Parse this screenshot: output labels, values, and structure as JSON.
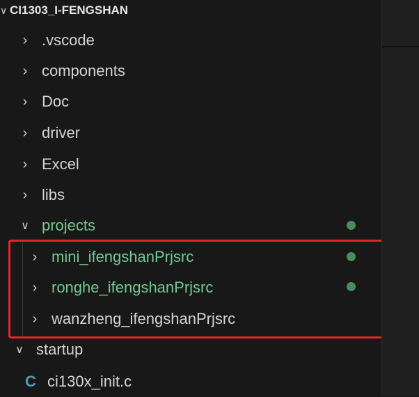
{
  "explorer": {
    "root_title": "CI1303_I-FENGSHAN",
    "items": [
      {
        "label": ".vscode"
      },
      {
        "label": "components"
      },
      {
        "label": "Doc"
      },
      {
        "label": "driver"
      },
      {
        "label": "Excel"
      },
      {
        "label": "libs"
      },
      {
        "label": "projects"
      },
      {
        "label": "mini_ifengshanPrjsrc"
      },
      {
        "label": "ronghe_ifengshanPrjsrc"
      },
      {
        "label": "wanzheng_ifengshanPrjsrc"
      },
      {
        "label": "startup"
      },
      {
        "label": "ci130x_init.c"
      }
    ],
    "icons": {
      "collapsed": "chevron-right-icon",
      "expanded": "chevron-down-icon",
      "c_file": "c-file-icon",
      "modified_dot": "git-modified-dot-icon"
    },
    "colors": {
      "background": "#181818",
      "text": "#d4d4d4",
      "git_modified": "#73c991",
      "dot": "#4b8a5b",
      "c_icon": "#519aba",
      "highlight_border": "#e5252a"
    }
  }
}
